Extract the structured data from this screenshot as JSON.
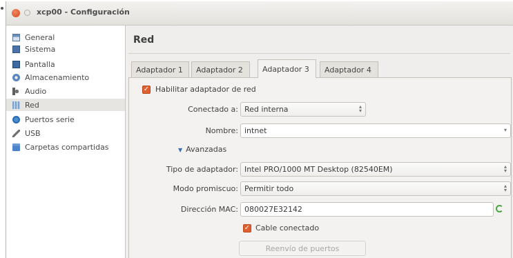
{
  "window": {
    "title": "xcp00 - Configuración"
  },
  "sidebar": {
    "items": [
      {
        "label": "General",
        "icon": "general-icon"
      },
      {
        "label": "Sistema",
        "icon": "chip-icon"
      },
      {
        "label": "Pantalla",
        "icon": "monitor-icon"
      },
      {
        "label": "Almacenamiento",
        "icon": "disk-icon"
      },
      {
        "label": "Audio",
        "icon": "speaker-icon"
      },
      {
        "label": "Red",
        "icon": "network-icon",
        "selected": true
      },
      {
        "label": "Puertos serie",
        "icon": "serial-port-icon"
      },
      {
        "label": "USB",
        "icon": "usb-icon"
      },
      {
        "label": "Carpetas compartidas",
        "icon": "folder-icon"
      }
    ]
  },
  "panel": {
    "title": "Red"
  },
  "tabs": [
    {
      "label": "Adaptador 1"
    },
    {
      "label": "Adaptador 2"
    },
    {
      "label": "Adaptador 3",
      "active": true
    },
    {
      "label": "Adaptador 4"
    }
  ],
  "form": {
    "enable_adapter": {
      "label": "Habilitar adaptador de red",
      "checked": true
    },
    "connected_to": {
      "label": "Conectado a:",
      "value": "Red interna"
    },
    "name": {
      "label": "Nombre:",
      "value": "intnet"
    },
    "advanced": {
      "label": "Avanzadas"
    },
    "adapter_type": {
      "label": "Tipo de adaptador:",
      "value": "Intel PRO/1000 MT Desktop (82540EM)"
    },
    "promiscuous": {
      "label": "Modo promiscuo:",
      "value": "Permitir todo"
    },
    "mac": {
      "label": "Dirección MAC:",
      "value": "080027E32142"
    },
    "cable": {
      "label": "Cable conectado",
      "checked": true
    },
    "port_forwarding": {
      "label": "Reenvío de puertos"
    }
  },
  "colors": {
    "accent": "#e06030",
    "selected_bg": "#e7e5e1"
  }
}
